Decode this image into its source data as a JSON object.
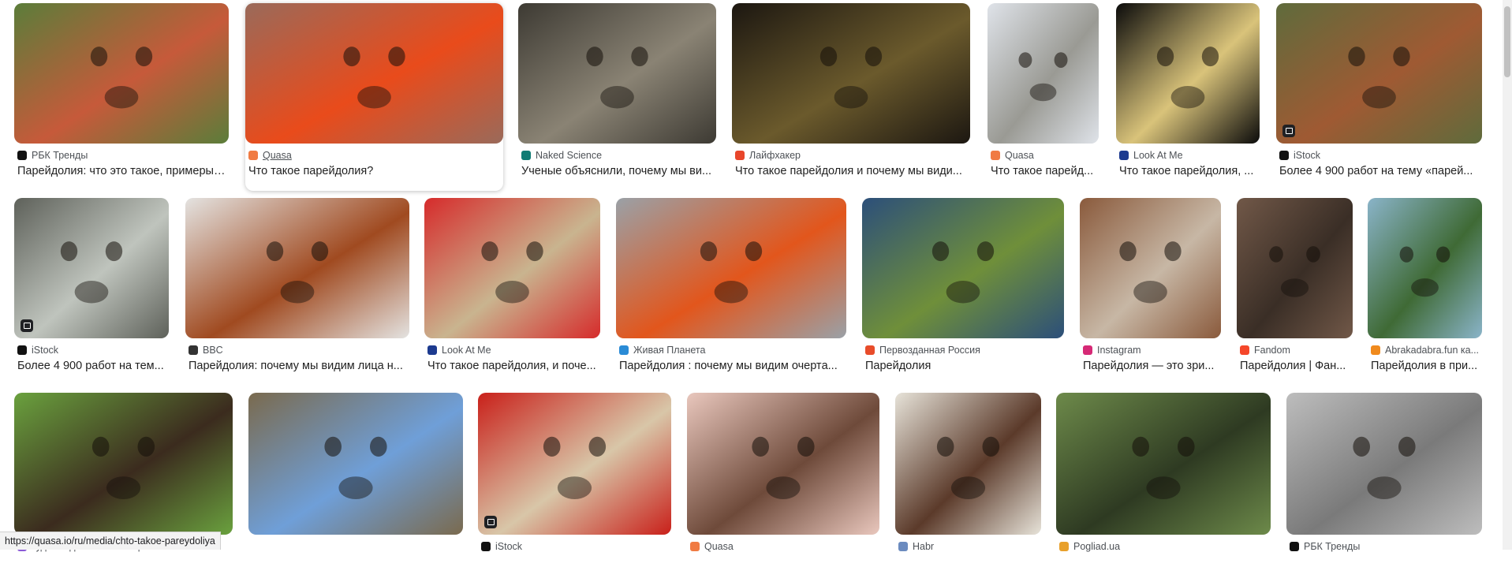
{
  "status_url": "https://quasa.io/ru/media/chto-takoe-pareydoliya",
  "results": [
    {
      "source": "РБК Тренды",
      "title": "Парейдолия: что это такое, примеры ...",
      "fav": "#111111",
      "c1": "#c65a3a",
      "c2": "#5b7d3a"
    },
    {
      "source": "Quasa",
      "title": "Что такое парейдолия?",
      "fav": "#f07b43",
      "c1": "#e94b1b",
      "c2": "#9a6a5a",
      "hover": true
    },
    {
      "source": "Naked Science",
      "title": "Ученые объяснили, почему мы ви...",
      "fav": "#0f7b74",
      "c1": "#8a8374",
      "c2": "#3d3a33"
    },
    {
      "source": "Лайфхакер",
      "title": "Что такое парейдолия и почему мы види...",
      "fav": "#e8462b",
      "c1": "#6b5a2c",
      "c2": "#1c1711"
    },
    {
      "source": "Quasa",
      "title": "Что такое парейд...",
      "fav": "#f07b43",
      "c1": "#9a9a94",
      "c2": "#dfe3e9"
    },
    {
      "source": "Look At Me",
      "title": "Что такое парейдолия, ...",
      "fav": "#1c3a8f",
      "c1": "#d9c37a",
      "c2": "#0b0b0b"
    },
    {
      "source": "iStock",
      "title": "Более 4 900 работ на тему «парей...",
      "fav": "#111111",
      "c1": "#9f5a33",
      "c2": "#5f6b3c",
      "cam": true
    },
    {
      "source": "iStock",
      "title": "Более 4 900 работ на тем...",
      "fav": "#111111",
      "c1": "#bfc4bd",
      "c2": "#5e615a",
      "cam": true
    },
    {
      "source": "BBC",
      "title": "Парейдолия: почему мы видим лица н...",
      "fav": "#333333",
      "c1": "#a04a20",
      "c2": "#e4e3e1"
    },
    {
      "source": "Look At Me",
      "title": "Что такое парейдолия, и поче...",
      "fav": "#1c3a8f",
      "c1": "#c9b48f",
      "c2": "#d62b2b"
    },
    {
      "source": "Живая Планета",
      "title": "Парейдолия : почему мы видим очертa...",
      "fav": "#2a8bd6",
      "c1": "#e2561c",
      "c2": "#9aa1a7"
    },
    {
      "source": "Первозданная Россия",
      "title": "Парейдолия",
      "fav": "#e84c2a",
      "c1": "#6f8f3a",
      "c2": "#2c4f7a"
    },
    {
      "source": "Instagram",
      "title": "Парейдолия — это зри...",
      "fav": "#d62976",
      "c1": "#c7b7a5",
      "c2": "#8a5a3c"
    },
    {
      "source": "Fandom",
      "title": "Парейдолия | Фан...",
      "fav": "#f5472a",
      "c1": "#3a2e26",
      "c2": "#715848"
    },
    {
      "source": "Abrakadabra.fun ка...",
      "title": "Парейдолия в при...",
      "fav": "#f08a1d",
      "c1": "#3f6a35",
      "c2": "#8ab4c9"
    },
    {
      "source": "куда сходить в Москве | А-а-ах!",
      "title": "",
      "fav": "#8a5ad6",
      "c1": "#3b2b1e",
      "c2": "#6aa13e"
    },
    {
      "source": "",
      "title": "",
      "fav": "#333",
      "c1": "#6f9fd8",
      "c2": "#7a6a4e"
    },
    {
      "source": "iStock",
      "title": "",
      "fav": "#111111",
      "c1": "#d8c6a8",
      "c2": "#c9201a",
      "cam": true
    },
    {
      "source": "Quasa",
      "title": "",
      "fav": "#f07b43",
      "c1": "#6e4a3a",
      "c2": "#e9c7bd"
    },
    {
      "source": "Habr",
      "title": "",
      "fav": "#6b8bbf",
      "c1": "#5b3a2a",
      "c2": "#e7e3d9"
    },
    {
      "source": "Pogliad.ua",
      "title": "",
      "fav": "#e8a02b",
      "c1": "#2e3a22",
      "c2": "#6d8a4a"
    },
    {
      "source": "РБК Тренды",
      "title": "",
      "fav": "#111111",
      "c1": "#7a7a7a",
      "c2": "#bdbdbd"
    }
  ]
}
